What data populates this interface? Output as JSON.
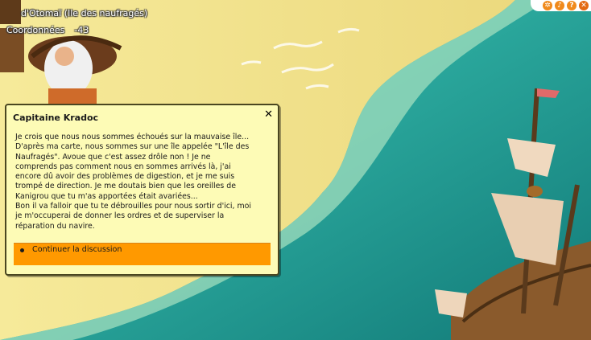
{
  "map": {
    "location": "d'Otomaï (Ile des naufragés)",
    "coords_label": "Coordonnées",
    "coords_value": "-43"
  },
  "corner_buttons": [
    {
      "icon": "settings-icon",
      "glyph": "✲"
    },
    {
      "icon": "sound-icon",
      "glyph": "♪"
    },
    {
      "icon": "help-icon",
      "glyph": "?"
    },
    {
      "icon": "close-icon",
      "glyph": "✕"
    }
  ],
  "dialog": {
    "title": "Capitaine Kradoc",
    "close_glyph": "✕",
    "text": "Je crois que nous nous sommes échoués sur la mauvaise île...\nD'après ma carte, nous sommes sur une île appelée \"L'île des\nNaufragés\". Avoue que c'est assez drôle non ! Je ne\ncomprends pas comment nous en sommes arrivés là, j'ai\nencore dû avoir des problèmes de digestion, et je me suis\ntrompé de direction. Je me doutais bien que les oreilles de\nKanigrou que tu m'as apportées était avariées...\nBon il va falloir que tu te débrouilles pour nous sortir d'ici, moi\nje m'occuperai de donner les ordres et de superviser la\nréparation du navire.",
    "reply": "Continuer la discussion"
  },
  "colors": {
    "sand": "#f2e38c",
    "sea": "#1f8f8a",
    "dialog_bg": "#fdfbb6",
    "reply_bg": "#ff9900",
    "accent_orange": "#f08a1c"
  }
}
